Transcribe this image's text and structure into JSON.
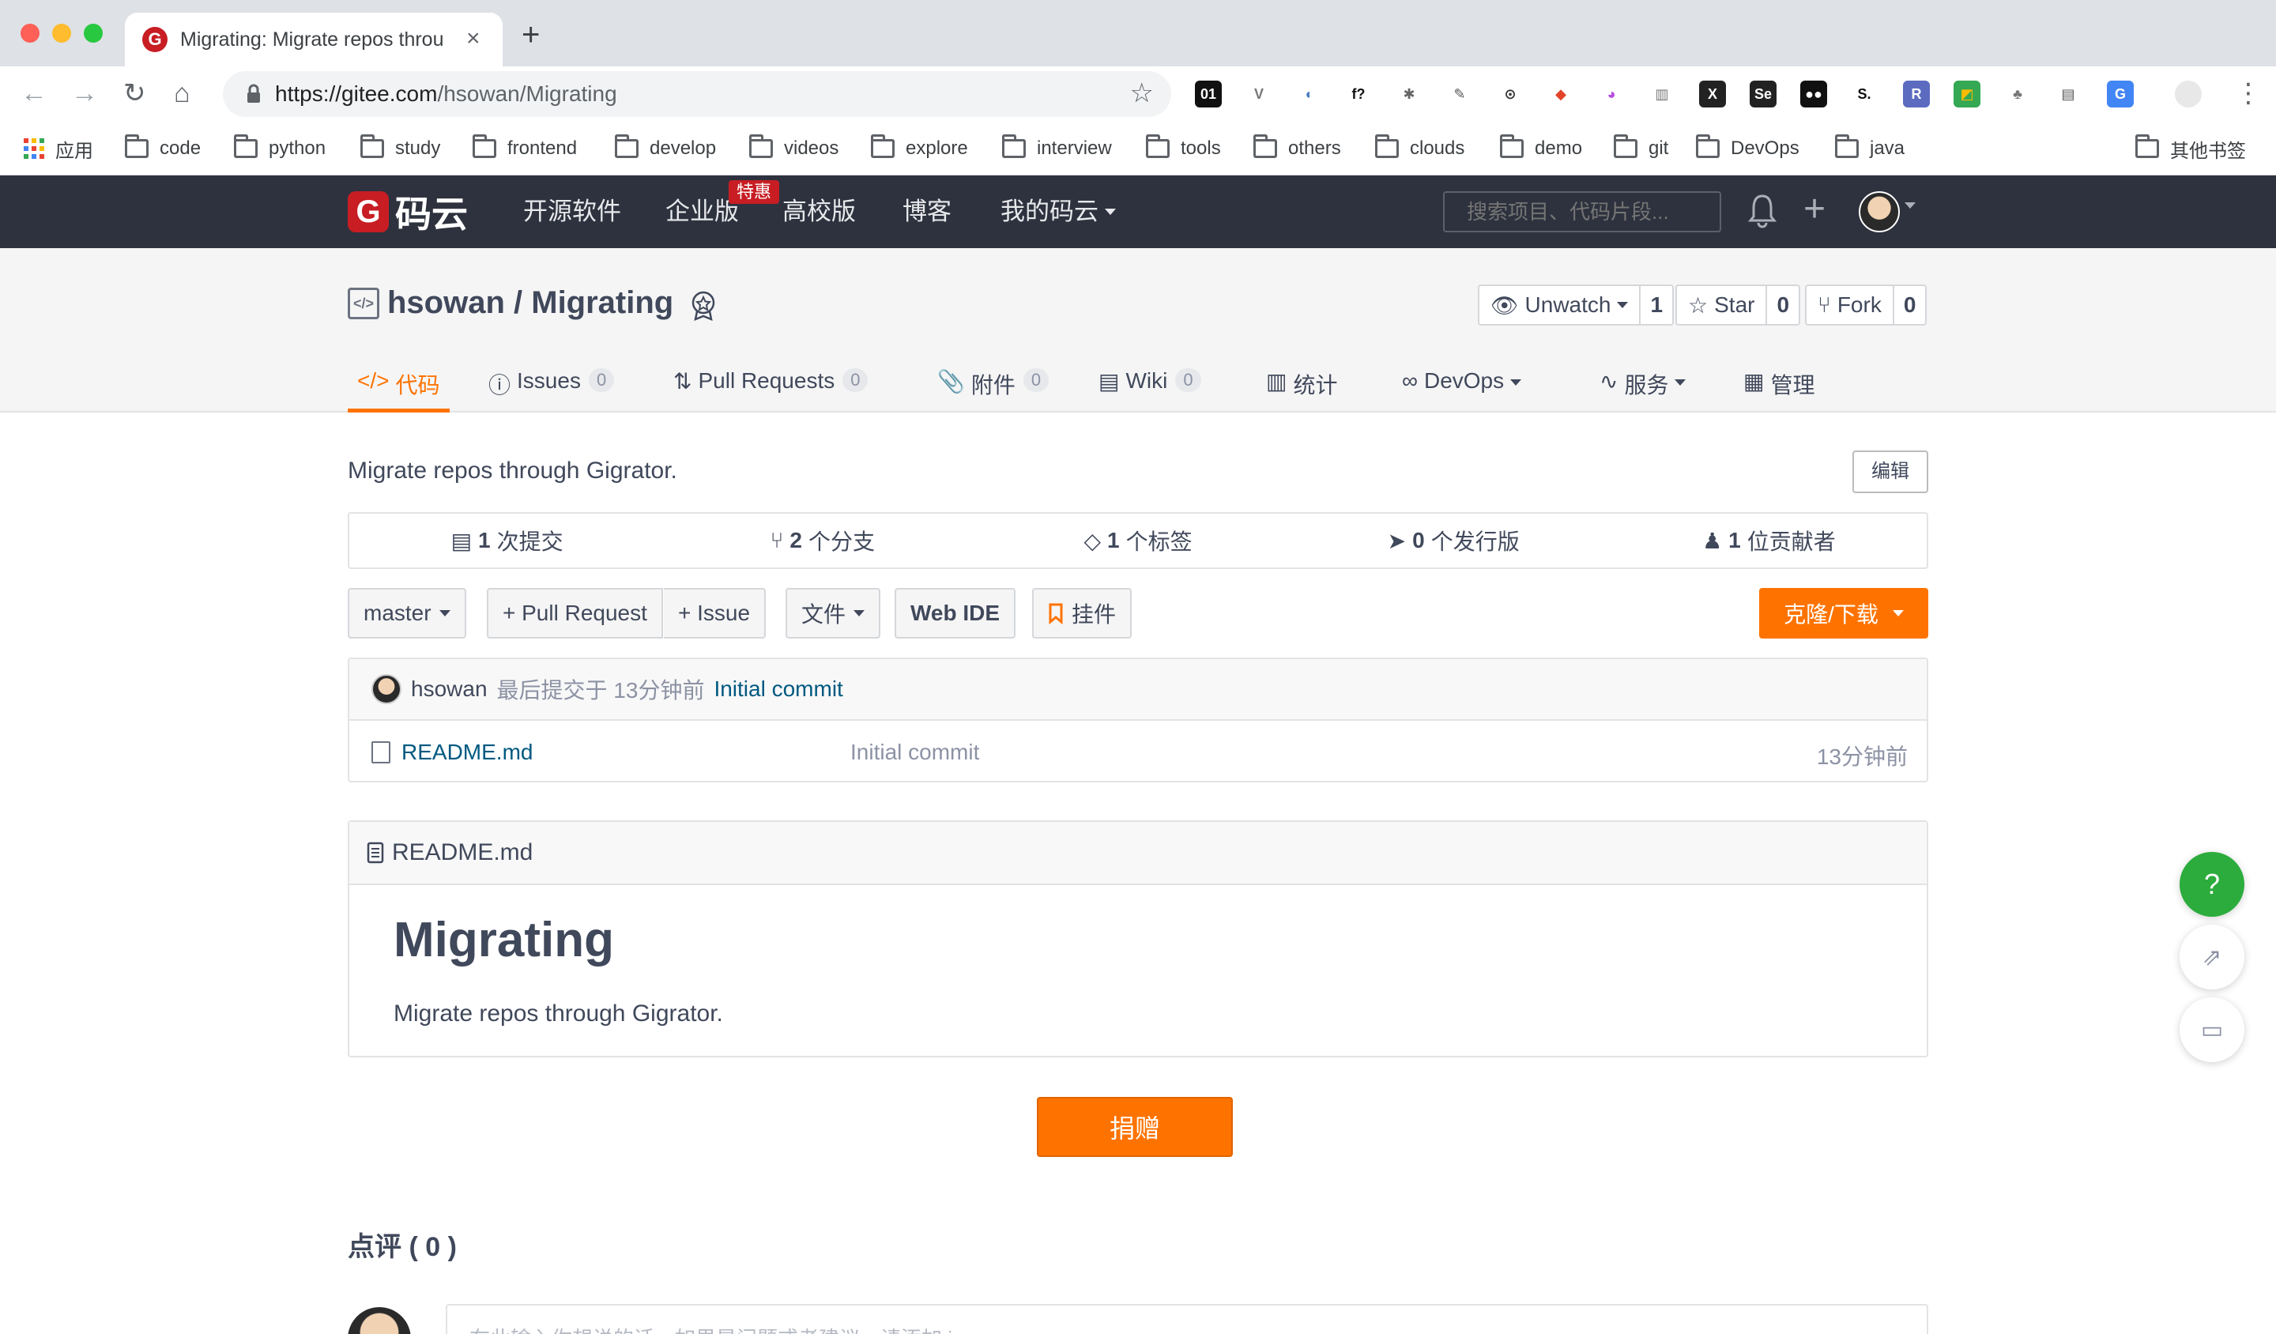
{
  "browser": {
    "tab_title": "Migrating: Migrate repos throu",
    "new_tab": "+",
    "tab_close": "×",
    "url_host": "https://gitee.com",
    "url_path": "/hsowan/Migrating",
    "back": "←",
    "forward": "→",
    "reload": "↻",
    "home": "⌂",
    "star": "☆",
    "bookmarks": [
      {
        "label": "应用",
        "icon": "apps-icon"
      },
      {
        "label": "code"
      },
      {
        "label": "python"
      },
      {
        "label": "study"
      },
      {
        "label": "frontend"
      },
      {
        "label": "develop"
      },
      {
        "label": "videos"
      },
      {
        "label": "explore"
      },
      {
        "label": "interview"
      },
      {
        "label": "tools"
      },
      {
        "label": "others"
      },
      {
        "label": "clouds"
      },
      {
        "label": "demo"
      },
      {
        "label": "git"
      },
      {
        "label": "DevOps"
      },
      {
        "label": "java"
      }
    ],
    "other_bookmarks": "其他书签",
    "extensions": [
      {
        "glyph": "01",
        "bg": "#111",
        "fg": "#fff"
      },
      {
        "glyph": "V",
        "bg": "#fff",
        "fg": "#777"
      },
      {
        "glyph": "◐",
        "bg": "#fff",
        "fg": "#4a7fc1"
      },
      {
        "glyph": "f?",
        "bg": "#fff",
        "fg": "#111"
      },
      {
        "glyph": "✱",
        "bg": "#fff",
        "fg": "#666"
      },
      {
        "glyph": "✎",
        "bg": "#fff",
        "fg": "#555"
      },
      {
        "glyph": "⊙",
        "bg": "#fff",
        "fg": "#333"
      },
      {
        "glyph": "◆",
        "bg": "#fff",
        "fg": "#e24329"
      },
      {
        "glyph": "◕",
        "bg": "#fff",
        "fg": "#b44be1"
      },
      {
        "glyph": "▥",
        "bg": "#fff",
        "fg": "#777"
      },
      {
        "glyph": "X",
        "bg": "#222",
        "fg": "#fff"
      },
      {
        "glyph": "Se",
        "bg": "#222",
        "fg": "#fff"
      },
      {
        "glyph": "●●",
        "bg": "#111",
        "fg": "#fff"
      },
      {
        "glyph": "S.",
        "bg": "#fff",
        "fg": "#111"
      },
      {
        "glyph": "R",
        "bg": "#5c6bc0",
        "fg": "#fff"
      },
      {
        "glyph": "◩",
        "bg": "#34a853",
        "fg": "#fbbc05"
      },
      {
        "glyph": "♣",
        "bg": "#fff",
        "fg": "#777"
      },
      {
        "glyph": "▤",
        "bg": "#fff",
        "fg": "#555"
      },
      {
        "glyph": "G",
        "bg": "#4285f4",
        "fg": "#fff"
      }
    ],
    "menu": "⋮"
  },
  "gitee": {
    "logo_mark": "G",
    "logo_text": "码云",
    "nav": [
      "开源软件",
      "企业版",
      "高校版",
      "博客",
      "我的码云"
    ],
    "promo_badge": "特惠",
    "search_placeholder": "搜索项目、代码片段...",
    "plus": "+"
  },
  "repo": {
    "owner": "hsowan",
    "name": "Migrating",
    "full_name": "hsowan / Migrating",
    "watch_label": "Unwatch",
    "watch_count": "1",
    "star_label": "Star",
    "star_count": "0",
    "fork_label": "Fork",
    "fork_count": "0",
    "tabs": [
      {
        "label": "代码",
        "icon": "</>",
        "count": null,
        "active": true
      },
      {
        "label": "Issues",
        "icon": "ⓘ",
        "count": "0"
      },
      {
        "label": "Pull Requests",
        "icon": "⇅",
        "count": "0"
      },
      {
        "label": "附件",
        "icon": "📎",
        "count": "0"
      },
      {
        "label": "Wiki",
        "icon": "▤",
        "count": "0"
      },
      {
        "label": "统计",
        "icon": "▥",
        "count": null
      },
      {
        "label": "DevOps",
        "icon": "∞",
        "count": null,
        "dropdown": true
      },
      {
        "label": "服务",
        "icon": "∿",
        "count": null,
        "dropdown": true
      },
      {
        "label": "管理",
        "icon": "▦",
        "count": null
      }
    ],
    "description": "Migrate repos through Gigrator.",
    "edit_label": "编辑",
    "stats": [
      {
        "icon": "▤",
        "value": "1",
        "label": "次提交"
      },
      {
        "icon": "⑂",
        "value": "2",
        "label": "个分支"
      },
      {
        "icon": "◇",
        "value": "1",
        "label": "个标签"
      },
      {
        "icon": "➤",
        "value": "0",
        "label": "个发行版"
      },
      {
        "icon": "♟",
        "value": "1",
        "label": "位贡献者"
      }
    ],
    "branch": "master",
    "pr_button": "+ Pull Request",
    "issue_button": "+ Issue",
    "file_button": "文件",
    "webide_button": "Web IDE",
    "widget_button": "挂件",
    "clone_button": "克隆/下载",
    "last_commit": {
      "author": "hsowan",
      "meta": "最后提交于 13分钟前",
      "message": "Initial commit"
    },
    "files": [
      {
        "name": "README.md",
        "commit": "Initial commit",
        "time": "13分钟前"
      }
    ],
    "readme": {
      "filename": "README.md",
      "heading": "Migrating",
      "body": "Migrate repos through Gigrator."
    },
    "donate_label": "捐赠",
    "comments_title": "点评 ( 0 )",
    "comment_placeholder": "在此输入你想说的话，如果是问题或者建议，请添加 issue"
  },
  "fabs": {
    "help": "?",
    "share": "⇗",
    "chat": "▭"
  },
  "colors": {
    "accent": "#fe7300",
    "header_bg": "#2e323e",
    "brand_red": "#c71d23",
    "link": "#005980",
    "help_green": "#2cac3c"
  }
}
